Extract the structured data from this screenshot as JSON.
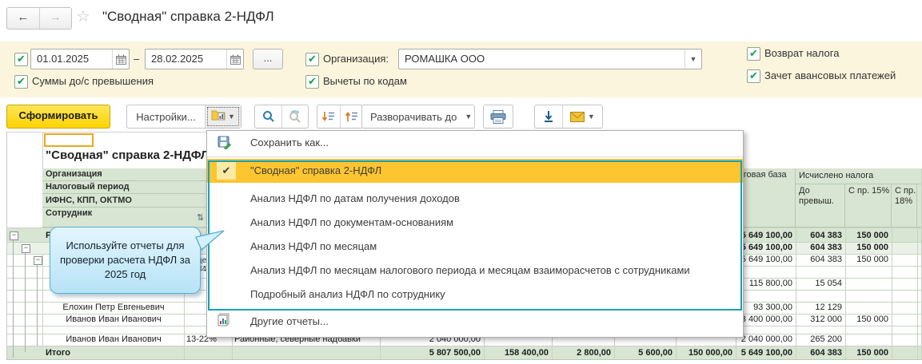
{
  "topbar": {
    "title": "\"Сводная\" справка 2-НДФЛ",
    "back": "←",
    "forward": "→",
    "star": "☆"
  },
  "filters": {
    "period_from": "01.01.2025",
    "period_to": "28.02.2025",
    "dash": "–",
    "more_label": "...",
    "org_label": "Организация:",
    "org_value": "РОМАШКА ООО",
    "cb_sums": "Суммы до/с превышения",
    "cb_deductions": "Вычеты по кодам",
    "cb_refund": "Возврат налога",
    "cb_advance": "Зачет авансовых платежей",
    "check": "✔"
  },
  "toolbar": {
    "generate": "Сформировать",
    "settings": "Настройки...",
    "expand_to": "Разворачивать до"
  },
  "menu": {
    "save_as": "Сохранить как...",
    "check": "✔",
    "items": [
      {
        "label": "\"Сводная\" справка 2-НДФЛ"
      },
      {
        "label": "Анализ НДФЛ по датам получения доходов"
      },
      {
        "label": "Анализ НДФЛ по документам-основаниям"
      },
      {
        "label": "Анализ НДФЛ по месяцам"
      },
      {
        "label": "Анализ НДФЛ по месяцам налогового периода и месяцам взаиморасчетов с сотрудниками"
      },
      {
        "label": "Подробный анализ НДФЛ по сотруднику"
      }
    ],
    "other_reports": "Другие отчеты..."
  },
  "callout": {
    "text": "Используйте отчеты для проверки расчета НДФЛ за 2025 год"
  },
  "table": {
    "title": "\"Сводная\" справка 2-НДФЛ",
    "row_headers": [
      "Организация",
      "Налоговый период",
      "ИФНС, КПП, ОКТМО",
      "Сотрудник"
    ],
    "sort_icon": "⇅",
    "col_tax_base": "Налоговая база",
    "col_calculated": "Исчислено налога",
    "col_until": "До превыш.",
    "col_pr15": "С пр. 15%",
    "col_pr18": "С пр. 18%",
    "org_row": {
      "name": "РОМАШКА ООО",
      "base": "5 649 100,00",
      "until": "604 383",
      "pr15": "150 000"
    },
    "period_row": {
      "base": "5 649 100,00",
      "until": "604 383",
      "pr15": "150 000"
    },
    "ifns_row": {
      "base": "5 649 100,00",
      "until": "604 383",
      "pr15": "150 000",
      "frag_a": "цео",
      "frag_b": "842"
    },
    "sub_row": {
      "base": "115 800,00",
      "until": "15 054"
    },
    "emp1": {
      "name": "Елохин Петр Евгеньевич",
      "base": "93 300,00",
      "until": "12 129"
    },
    "emp2": {
      "name": "Иванов Иван Иванович",
      "base": "3 400 000,00",
      "until": "312 000",
      "pr15": "150 000"
    },
    "emp3": {
      "name": "Иванов Иван Иванович",
      "rate": "13-22%",
      "income": "Районные, северные надбавки",
      "accrued": "2 040 000,00",
      "base": "2 040 000,00",
      "until": "265 200"
    },
    "total": {
      "label": "Итого",
      "accrued": "5 807 500,00",
      "c2": "158 400,00",
      "c3": "2 800,00",
      "c4": "5 600,00",
      "c5": "150 000,00",
      "base": "5 649 100,00",
      "until": "604 383",
      "pr15": "150 000"
    },
    "expander": "−"
  },
  "colors": {
    "accent_yellow": "#fdc52f",
    "teal": "#18a0b5",
    "header_green": "#d7e5d2",
    "panel_yellow": "#fbf5dd"
  }
}
